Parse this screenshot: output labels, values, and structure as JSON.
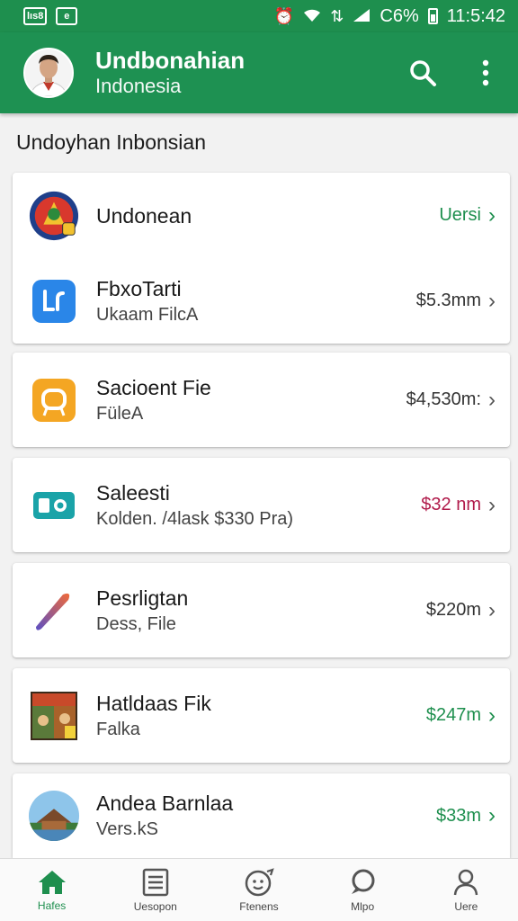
{
  "status_bar": {
    "left_badges": [
      "lıs8",
      "e"
    ],
    "icons": [
      "alarm-icon",
      "wifi-icon",
      "data-icon",
      "signal-icon",
      "battery-icon"
    ],
    "battery": "C6%",
    "time": "11:5:42"
  },
  "app_bar": {
    "title": "Undbonahian",
    "subtitle": "Indonesia",
    "accent": "#1e9152"
  },
  "section_title": "Undoyhan Inbonsian",
  "cards": [
    {
      "rows": [
        {
          "title": "Undonean",
          "subtitle": "",
          "value": "Uersi",
          "value_color": "#1e8f4e",
          "icon": "emblem-icon"
        },
        {
          "title": "FbxoTarti",
          "subtitle": "Ukaam FilcA",
          "value": "$5.3mm",
          "value_color": "#333333",
          "icon": "blue-app-icon"
        }
      ]
    },
    {
      "rows": [
        {
          "title": "Sacioent Fie",
          "subtitle": "FüleA",
          "value": "$4,530m:",
          "value_color": "#333333",
          "icon": "orange-app-icon"
        }
      ]
    },
    {
      "rows": [
        {
          "title": "Saleesti",
          "subtitle": "Kolden. /4lask $330 Pra)",
          "value": "$32 nm",
          "value_color": "#b01a4a",
          "icon": "teal-app-icon"
        }
      ]
    },
    {
      "rows": [
        {
          "title": "Pesrligtan",
          "subtitle": "Dess, File",
          "value": "$220m",
          "value_color": "#333333",
          "icon": "swoosh-icon"
        }
      ]
    },
    {
      "rows": [
        {
          "title": "Hatldaas Fik",
          "subtitle": "Falka",
          "value": "$247m",
          "value_color": "#1e8f4e",
          "icon": "game-cover-icon"
        }
      ]
    },
    {
      "rows": [
        {
          "title": "Andea Barnlaa",
          "subtitle": "Vers.kS",
          "value": "$33m",
          "value_color": "#1e8f4e",
          "icon": "landscape-thumbnail-icon"
        }
      ]
    }
  ],
  "bottom_nav": [
    {
      "label": "Hafes",
      "icon": "home-icon",
      "active": true
    },
    {
      "label": "Uesopon",
      "icon": "list-icon",
      "active": false
    },
    {
      "label": "Ftenens",
      "icon": "smiley-icon",
      "active": false
    },
    {
      "label": "Mlpo",
      "icon": "chat-icon",
      "active": false
    },
    {
      "label": "Uere",
      "icon": "person-icon",
      "active": false
    }
  ]
}
